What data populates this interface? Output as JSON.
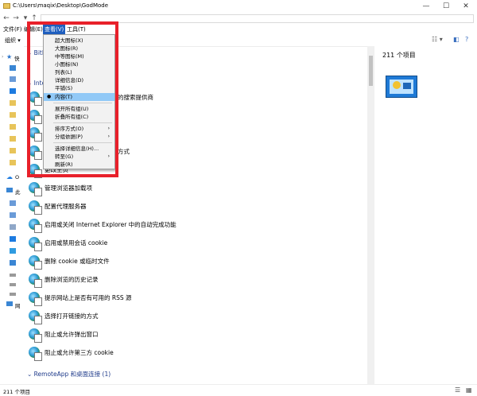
{
  "window": {
    "title": "C:\\Users\\maqix\\Desktop\\GodMode"
  },
  "menubar": {
    "items": [
      "文件(F)",
      "编辑(E)",
      "查看(V)",
      "工具(T)"
    ]
  },
  "toolbar": {
    "organize_label": "组织 ▾"
  },
  "view_menu": {
    "items": [
      {
        "label": "超大图标(X)"
      },
      {
        "label": "大图标(R)"
      },
      {
        "label": "中等图标(M)"
      },
      {
        "label": "小图标(N)"
      },
      {
        "label": "列表(L)"
      },
      {
        "label": "详细信息(D)"
      },
      {
        "label": "平铺(S)"
      },
      {
        "label": "内容(T)",
        "checked": true,
        "selected": true
      },
      {
        "label": "展开所有组(U)"
      },
      {
        "label": "折叠所有组(C)"
      },
      {
        "label": "排序方式(O)",
        "submenu": true
      },
      {
        "label": "分组依据(P)",
        "submenu": true
      },
      {
        "label": "选择详细信息(H)..."
      },
      {
        "label": "转至(G)",
        "submenu": true
      },
      {
        "label": "刷新(R)"
      }
    ]
  },
  "main": {
    "group1_header_partial": "BitLo",
    "group2_header_partial": "Inte",
    "hidden_partials": [
      "的搜索提供商",
      "方式",
      "更改主页"
    ],
    "items": [
      "管理浏览器加载项",
      "配置代理服务器",
      "启用或关闭 Internet Explorer 中的自动完成功能",
      "启用或禁用会话 cookie",
      "删除 cookie 或临时文件",
      "删除浏览的历史记录",
      "提示网站上是否有可用的 RSS 源",
      "选择打开链接的方式",
      "阻止或允许弹出窗口",
      "阻止或允许第三方 cookie"
    ],
    "group3_header": "RemoteApp 和桌面连接 (1)"
  },
  "details": {
    "count_text": "211 个项目"
  },
  "status": {
    "count_text": "211 个项目"
  },
  "nav": {
    "quick_access_partial": "快",
    "onedrive_partial": "O",
    "this_pc_partial": "此",
    "network_partial": "网"
  },
  "colors": {
    "highlight_red": "#e8202a",
    "menu_selection": "#91c9f7",
    "menu_active": "#1f5fbf"
  }
}
